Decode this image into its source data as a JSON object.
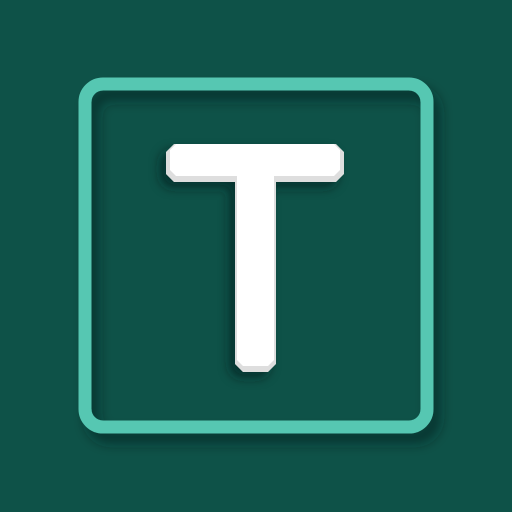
{
  "icon": {
    "name": "text-t-icon",
    "letter": "T",
    "colors": {
      "background": "#0e5248",
      "frame": "#56c7b2",
      "letter": "#ffffff",
      "letter_bevel": "#dedede"
    }
  }
}
